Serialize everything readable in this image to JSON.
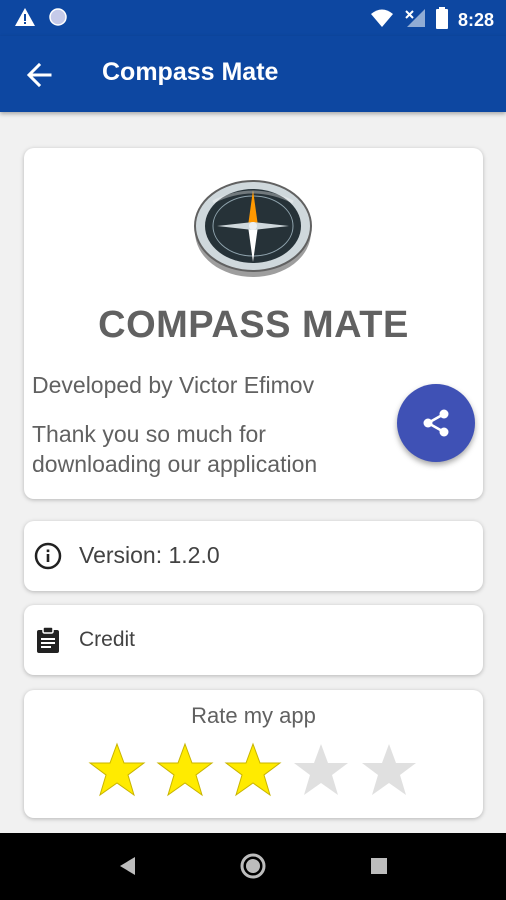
{
  "status_bar": {
    "time": "8:28",
    "icons": [
      "warning-icon",
      "circle-notification-icon",
      "wifi-icon",
      "signal-icon",
      "battery-icon"
    ]
  },
  "app_bar": {
    "title": "Compass Mate",
    "back_icon": "arrow-back-icon"
  },
  "main_card": {
    "title": "COMPASS MATE",
    "developer": "Developed by Victor Efimov",
    "thanks": "Thank you so much for downloading our application",
    "logo_icon": "compass-icon",
    "share_icon": "share-icon",
    "fab_color": "#3f51b5"
  },
  "version_card": {
    "text": "Version: 1.2.0",
    "icon": "info-icon"
  },
  "credit_card": {
    "text": "Credit",
    "icon": "clipboard-icon"
  },
  "rate_card": {
    "title": "Rate my app",
    "rating": 3,
    "max_rating": 5,
    "filled_color": "#ffeb00",
    "empty_color": "#e0e0e0"
  },
  "colors": {
    "primary": "#0d47a1",
    "accent": "#3f51b5",
    "background": "#f1f1f1"
  },
  "nav_bar": {
    "buttons": [
      "back-nav-icon",
      "home-nav-icon",
      "recents-nav-icon"
    ]
  }
}
